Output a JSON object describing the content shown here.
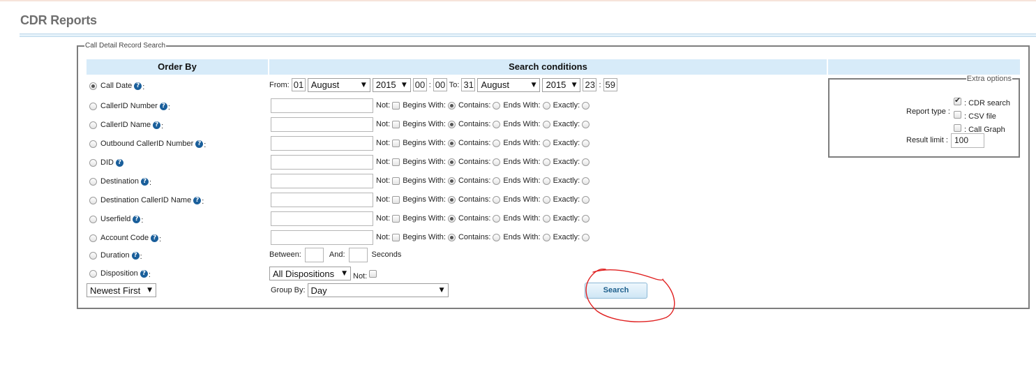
{
  "page": {
    "title": "CDR Reports"
  },
  "search": {
    "legend": "Call Detail Record Search",
    "headers": {
      "order_by": "Order By",
      "conditions": "Search conditions",
      "extra": ""
    },
    "call_date": {
      "label": "Call Date",
      "from_label": "From:",
      "from_day": "01",
      "from_month": "August",
      "from_year": "2015",
      "from_hour": "00",
      "from_minute": "00",
      "to_label": "To:",
      "to_day": "31",
      "to_month": "August",
      "to_year": "2015",
      "to_hour": "23",
      "to_minute": "59",
      "time_sep": ":"
    },
    "match_labels": {
      "not": "Not:",
      "begins": "Begins With:",
      "contains": "Contains:",
      "ends": "Ends With:",
      "exactly": "Exactly:"
    },
    "fields": [
      {
        "label": "CallerID Number",
        "colon": ":"
      },
      {
        "label": "CallerID Name",
        "colon": ":"
      },
      {
        "label": "Outbound CallerID Number",
        "colon": ":"
      },
      {
        "label": "DID",
        "colon": ""
      },
      {
        "label": "Destination",
        "colon": ":"
      },
      {
        "label": "Destination CallerID Name",
        "colon": ":"
      },
      {
        "label": "Userfield",
        "colon": ":"
      },
      {
        "label": "Account Code",
        "colon": ":"
      }
    ],
    "duration": {
      "label": "Duration",
      "between": "Between:",
      "and": "And:",
      "seconds": "Seconds"
    },
    "disposition": {
      "label": "Disposition",
      "selected": "All Dispositions",
      "not": "Not:"
    },
    "sort": {
      "selected": "Newest First"
    },
    "group_by": {
      "label": "Group By:",
      "selected": "Day"
    },
    "button": "Search",
    "help_glyph": "?",
    "select_arrow": "▼"
  },
  "extra": {
    "legend": "Extra options",
    "report_type_label": "Report type :",
    "options": [
      {
        "label": ": CDR search",
        "checked": true
      },
      {
        "label": ": CSV file",
        "checked": false
      },
      {
        "label": ": Call Graph",
        "checked": false
      }
    ],
    "result_limit_label": "Result limit :",
    "result_limit_value": "100"
  },
  "colors": {
    "header_bg": "#d7ebf9",
    "help_icon": "#1a5f9b",
    "annotation": "#e02020",
    "button_text": "#1d5f8c"
  },
  "icons": {
    "help": "help-circle-icon",
    "dropdown": "chevron-down-icon",
    "checkmark": "check-icon"
  }
}
